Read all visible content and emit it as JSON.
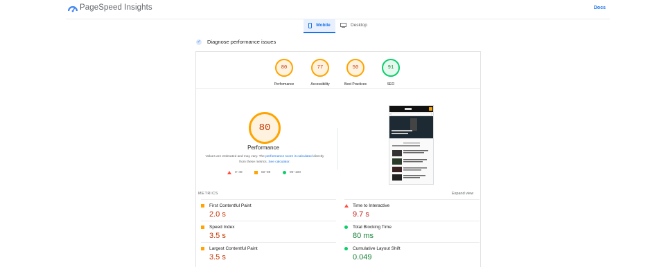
{
  "header": {
    "brand": "PageSpeed Insights",
    "docs_label": "Docs"
  },
  "tabs": [
    {
      "label": "Mobile",
      "active": true
    },
    {
      "label": "Desktop",
      "active": false
    }
  ],
  "diagnose_label": "Diagnose performance issues",
  "gauges": [
    {
      "score": "80",
      "label": "Performance",
      "color": "#ffa400"
    },
    {
      "score": "77",
      "label": "Accessibility",
      "color": "#ffa400"
    },
    {
      "score": "50",
      "label": "Best Practices",
      "color": "#ffa400"
    },
    {
      "score": "91",
      "label": "SEO",
      "color": "#0cce6b"
    }
  ],
  "performance": {
    "score": "80",
    "title": "Performance",
    "note_1": "Values are estimated and may vary. The ",
    "note_link1": "performance score is calculated",
    "note_2": " directly from these metrics. ",
    "note_link2": "See calculator."
  },
  "legend": [
    {
      "range": "0–49",
      "shape": "triangle",
      "color": "#ff4e42"
    },
    {
      "range": "50–89",
      "shape": "square",
      "color": "#ffa400"
    },
    {
      "range": "90–100",
      "shape": "circle",
      "color": "#0cce6b"
    }
  ],
  "metrics_label": "METRICS",
  "expand_label": "Expand view",
  "metrics": [
    {
      "name": "First Contentful Paint",
      "value": "2.0 s",
      "status": "average"
    },
    {
      "name": "Time to Interactive",
      "value": "9.7 s",
      "status": "fail"
    },
    {
      "name": "Speed Index",
      "value": "3.5 s",
      "status": "average"
    },
    {
      "name": "Total Blocking Time",
      "value": "80 ms",
      "status": "pass"
    },
    {
      "name": "Largest Contentful Paint",
      "value": "3.5 s",
      "status": "average"
    },
    {
      "name": "Cumulative Layout Shift",
      "value": "0.049",
      "status": "pass"
    }
  ],
  "colors": {
    "accent": "#1a73e8",
    "average": "#ffa400",
    "fail": "#ff4e42",
    "pass": "#0cce6b"
  }
}
